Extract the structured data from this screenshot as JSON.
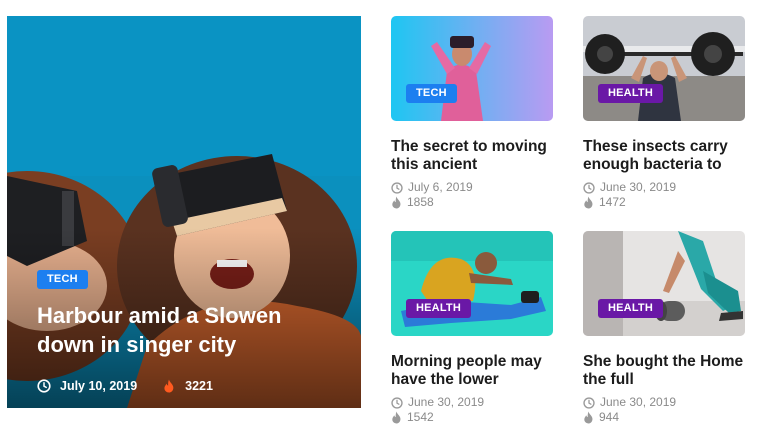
{
  "colors": {
    "tech": "#1c7ff0",
    "health": "#6a18a6",
    "flame": "#ff5a1f"
  },
  "featured": {
    "category": "TECH",
    "title": "Harbour amid a Slowen down in singer city",
    "date": "July 10, 2019",
    "views": "3221"
  },
  "posts": [
    {
      "category": "TECH",
      "title": "The secret to moving this ancient",
      "date": "July 6, 2019",
      "views": "1858"
    },
    {
      "category": "HEALTH",
      "title": "These insects carry enough bacteria to",
      "date": "June 30, 2019",
      "views": "1472"
    },
    {
      "category": "HEALTH",
      "title": "Morning people may have the lower",
      "date": "June 30, 2019",
      "views": "1542"
    },
    {
      "category": "HEALTH",
      "title": "She bought the Home the full",
      "date": "June 30, 2019",
      "views": "944"
    }
  ]
}
